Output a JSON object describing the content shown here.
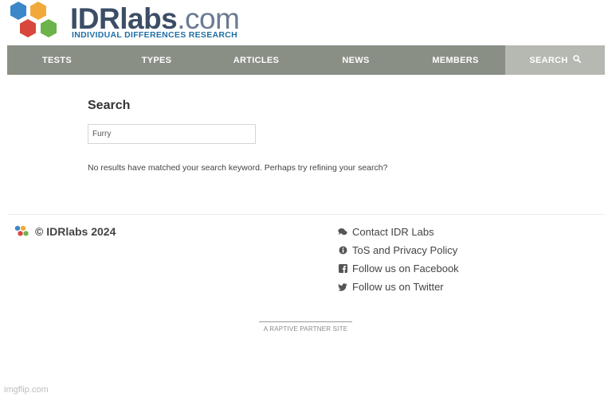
{
  "brand": {
    "name_bold": "IDRlabs",
    "name_domain": ".com",
    "tagline": "INDIVIDUAL DIFFERENCES RESEARCH",
    "colors": [
      "#3b87c9",
      "#f2a93b",
      "#d8473b",
      "#6bb34a",
      "#1f6fa6"
    ]
  },
  "nav": {
    "items": [
      {
        "label": "TESTS"
      },
      {
        "label": "TYPES"
      },
      {
        "label": "ARTICLES"
      },
      {
        "label": "NEWS"
      },
      {
        "label": "MEMBERS"
      },
      {
        "label": "SEARCH",
        "icon": "search-icon",
        "active": true
      }
    ]
  },
  "main": {
    "heading": "Search",
    "search_value": "Furry",
    "no_results": "No results have matched your search keyword. Perhaps try refining your search?"
  },
  "footer": {
    "copyright": "© IDRlabs 2024",
    "links": [
      {
        "label": "Contact IDR Labs",
        "icon": "chat-icon"
      },
      {
        "label": "ToS and Privacy Policy",
        "icon": "info-icon"
      },
      {
        "label": "Follow us on Facebook",
        "icon": "facebook-icon"
      },
      {
        "label": "Follow us on Twitter",
        "icon": "twitter-icon"
      }
    ],
    "partner": "A RAPTIVE PARTNER SITE"
  },
  "watermark": "imgflip.com"
}
